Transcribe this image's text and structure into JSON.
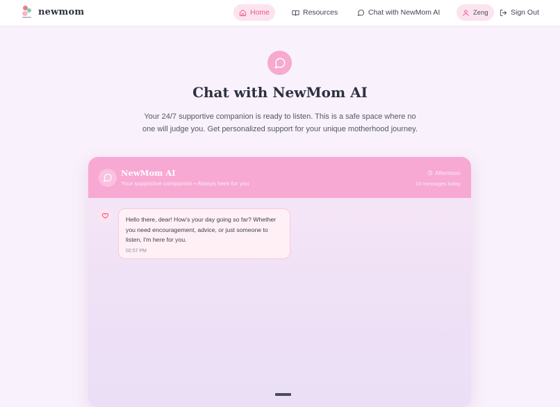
{
  "brand": {
    "name": "newmom"
  },
  "nav": {
    "home": "Home",
    "resources": "Resources",
    "chat": "Chat with NewMom AI",
    "user": "Zeng",
    "signout": "Sign Out"
  },
  "hero": {
    "title": "Chat with NewMom AI",
    "subtitle": "Your 24/7 supportive companion is ready to listen. This is a safe space where no one will judge you. Get personalized support for your unique motherhood journey."
  },
  "chat": {
    "bot_name": "NewMom AI",
    "bot_tagline": "Your supportive companion • Always here for you",
    "time_of_day": "Afternoon",
    "message_count": "10 messages today",
    "messages": [
      {
        "text": "Hello there, dear! How's your day going so far? Whether you need encouragement, advice, or just someone to listen, I'm here for you.",
        "time": "02:57 PM"
      }
    ]
  },
  "colors": {
    "accent": "#e9548b",
    "header_pink": "#f7a9d3",
    "background": "#f9f1fb"
  },
  "icons": {
    "home": "home-icon",
    "resources": "book-icon",
    "chat": "chat-bubble-icon",
    "user": "user-icon",
    "signout": "sign-out-icon",
    "bot": "chat-bubble-icon",
    "time": "clock-icon",
    "message_avatar": "heart-icon"
  }
}
